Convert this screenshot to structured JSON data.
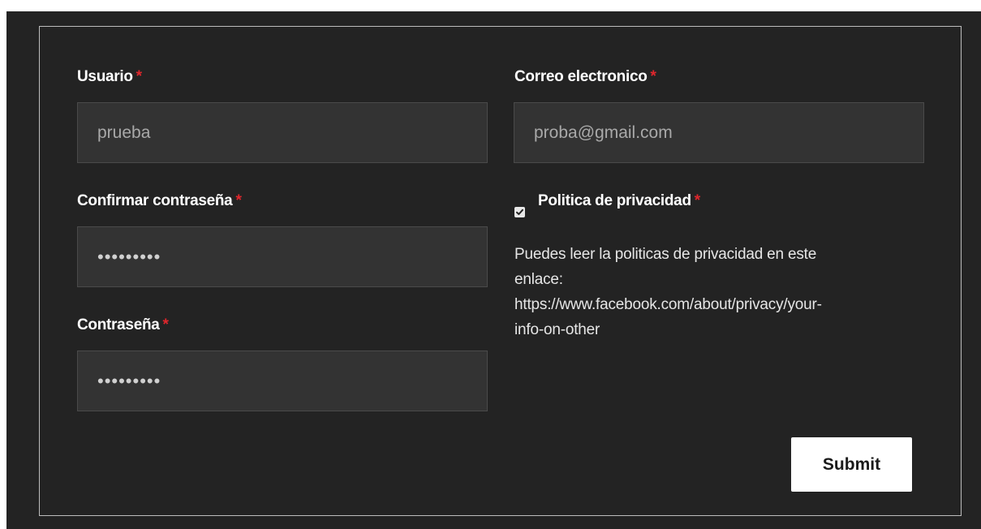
{
  "form": {
    "required_marker": "*",
    "usuario": {
      "label": "Usuario",
      "value": "prueba"
    },
    "correo": {
      "label": "Correo electronico",
      "value": "proba@gmail.com"
    },
    "confirmar": {
      "label": "Confirmar contraseña",
      "value": "•••••••••"
    },
    "contrasena": {
      "label": "Contraseña",
      "value": "•••••••••"
    },
    "privacidad": {
      "label": "Politica de privacidad",
      "checked": true,
      "text_lines": [
        "Puedes leer la politicas de privacidad en este",
        "enlace:",
        "https://www.facebook.com/about/privacy/your-",
        "info-on-other"
      ]
    },
    "submit_label": "Submit"
  },
  "colors": {
    "background": "#232323",
    "input_background": "#333333",
    "required": "#e0262c",
    "border": "#bdbdbd"
  }
}
